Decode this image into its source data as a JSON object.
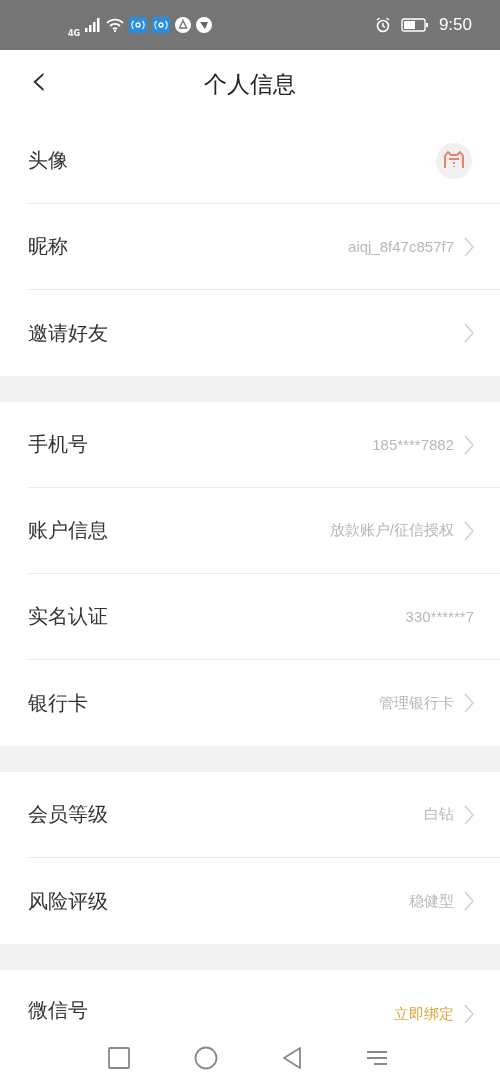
{
  "status_bar": {
    "network": "4G",
    "time": "9:50"
  },
  "header": {
    "back": "‹",
    "title": "个人信息"
  },
  "groups": [
    {
      "rows": [
        {
          "kind": "avatar",
          "label": "头像",
          "chevron": false
        },
        {
          "kind": "text",
          "label": "昵称",
          "value": "aiqj_8f47c857f7",
          "chevron": true,
          "highlighted": false
        },
        {
          "kind": "text",
          "label": "邀请好友",
          "chevron": true
        }
      ]
    },
    {
      "rows": [
        {
          "kind": "text",
          "label": "手机号",
          "value": "185****7882",
          "chevron": true,
          "highlighted": false
        },
        {
          "kind": "text",
          "label": "账户信息",
          "value": "放款账户/征信授权",
          "chevron": true,
          "highlighted": false
        },
        {
          "kind": "text",
          "label": "实名认证",
          "value": "330******7",
          "chevron": false,
          "highlighted": false
        },
        {
          "kind": "text",
          "label": "银行卡",
          "value": "管理银行卡",
          "chevron": true,
          "highlighted": false
        }
      ]
    },
    {
      "rows": [
        {
          "kind": "text",
          "label": "会员等级",
          "value": "白钻",
          "chevron": true,
          "highlighted": false
        },
        {
          "kind": "text",
          "label": "风险评级",
          "value": "稳健型",
          "chevron": true,
          "highlighted": false
        }
      ]
    },
    {
      "rows": [
        {
          "kind": "text",
          "label": "微信号",
          "value": "立即绑定",
          "chevron": true,
          "highlighted": true
        }
      ]
    }
  ]
}
